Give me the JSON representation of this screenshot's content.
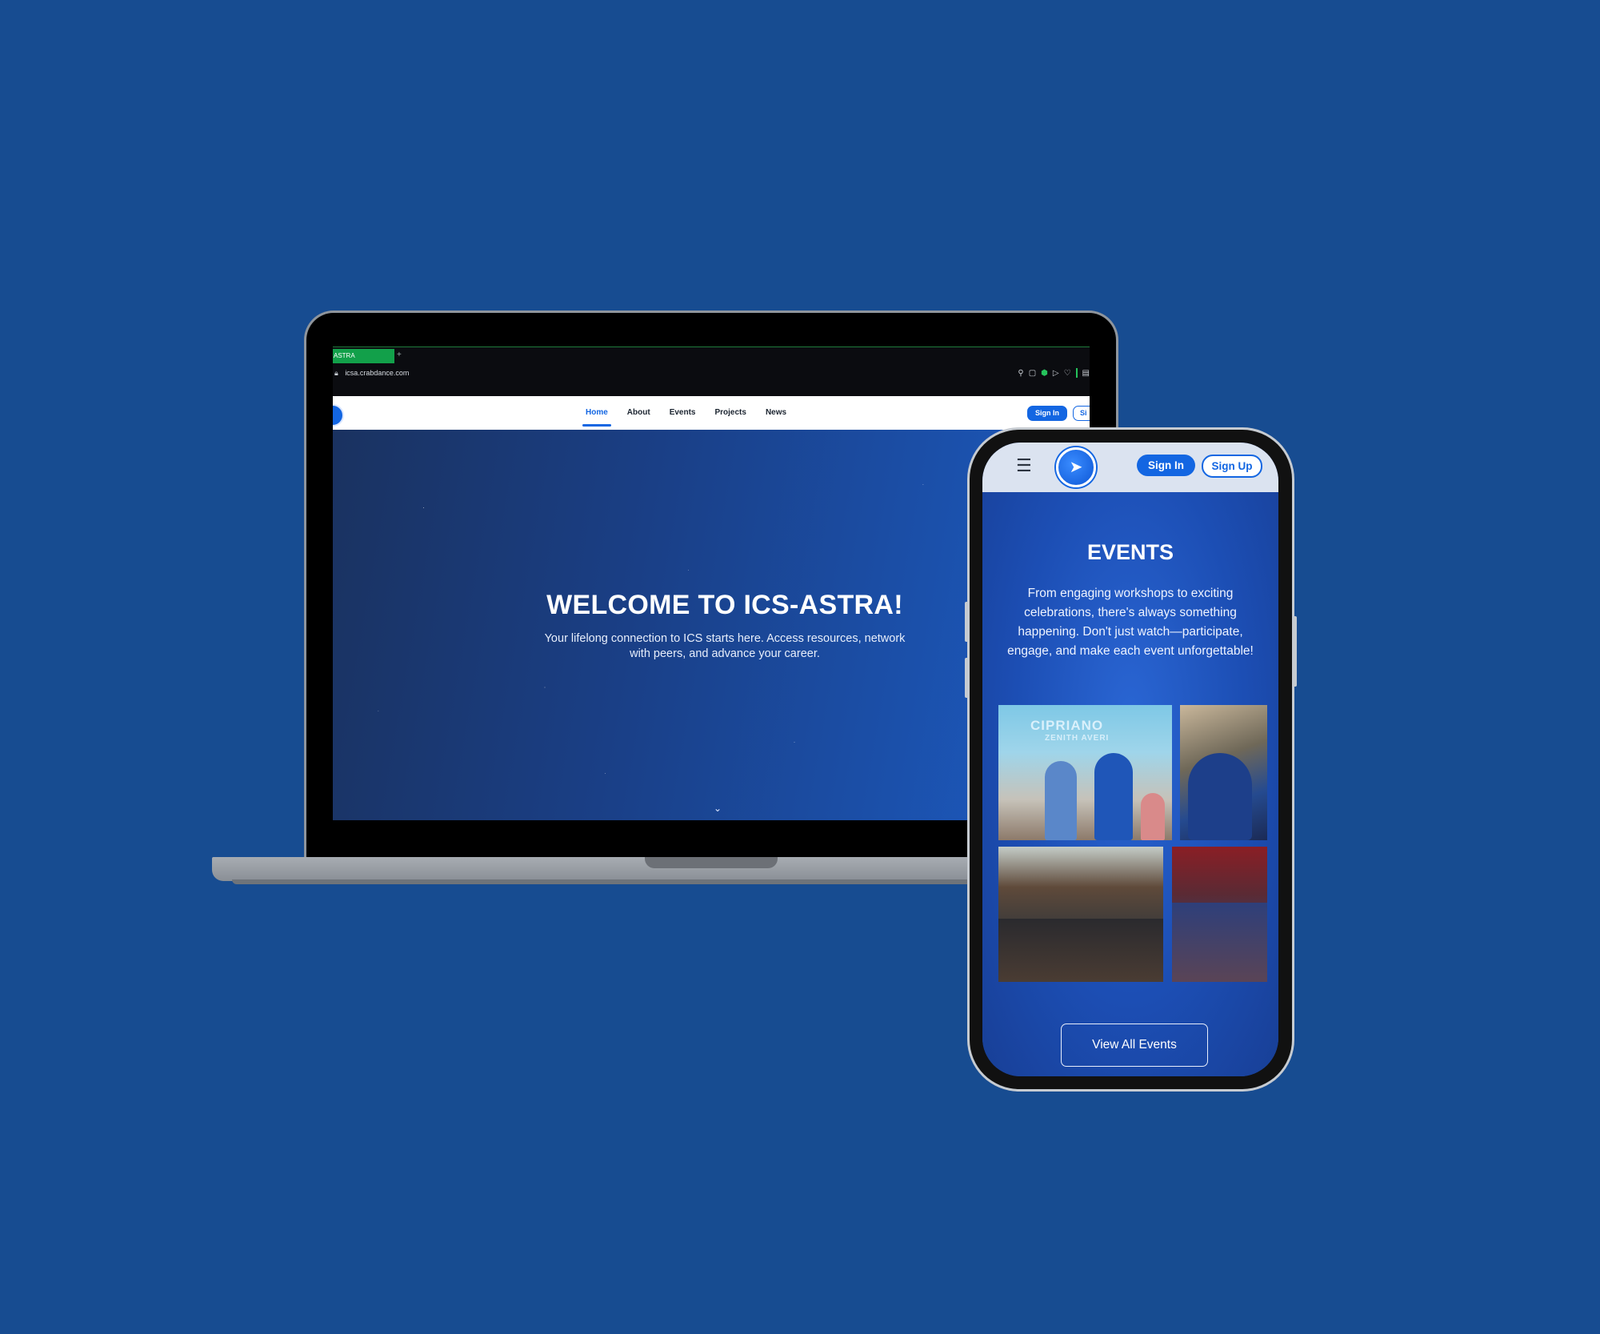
{
  "background_color": "#174c91",
  "accent_color": "#1366e2",
  "laptop": {
    "browser": {
      "tab_title": "ASTRA",
      "new_tab_icon": "plus-icon",
      "url": "icsa.crabdance.com",
      "lock_icon": "lock-icon"
    },
    "site_nav": {
      "links": [
        "Home",
        "About",
        "Events",
        "Projects",
        "News"
      ],
      "active_link": "Home",
      "signin_label": "Sign In",
      "signup_label": "Si"
    },
    "hero": {
      "title": "WELCOME TO ICS-ASTRA!",
      "subtitle_line1": "Your lifelong connection to ICS starts here. Access resources, network",
      "subtitle_line2": "with peers, and advance your career.",
      "scroll_icon": "chevron-down-icon"
    }
  },
  "phone": {
    "header": {
      "menu_icon": "hamburger-icon",
      "logo_icon": "rocket-icon",
      "signin_label": "Sign In",
      "signup_label": "Sign Up"
    },
    "events": {
      "title": "EVENTS",
      "description_line1": "From engaging workshops to exciting",
      "description_line2": "celebrations, there's always something",
      "description_line3": "happening. Don't just watch—participate,",
      "description_line4": "engage, and make each event unforgettable!",
      "photo1_sign_line1": "CIPRIANO",
      "photo1_sign_line2": "ZENITH AVERI",
      "view_all_label": "View All Events"
    }
  }
}
